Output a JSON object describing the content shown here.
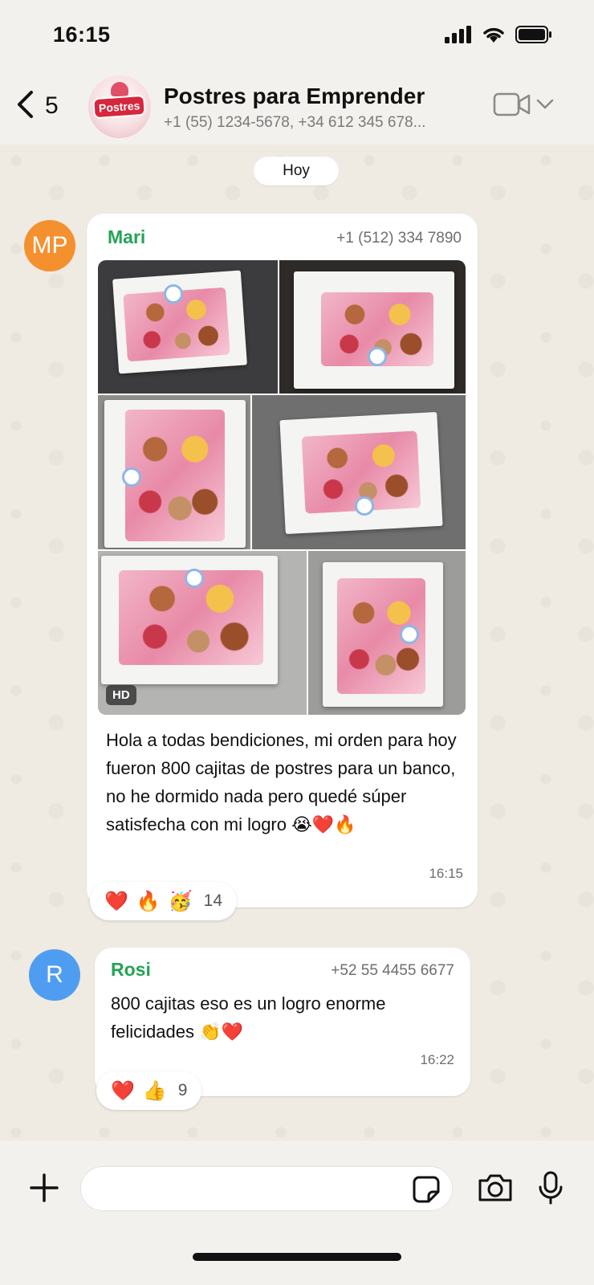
{
  "status_bar": {
    "time": "16:15"
  },
  "header": {
    "back_count": "5",
    "group_avatar_text": "Postres",
    "title": "Postres para Emprender",
    "subtitle": "+1 (55) 1234-5678, +34 612 345 678..."
  },
  "date_chip": "Hoy",
  "messages": [
    {
      "avatar_initials": "MP",
      "avatar_color": "#f5902f",
      "sender": "Mari",
      "phone": "+1 (512) 334 7890",
      "photos_count": 6,
      "hd_label": "HD",
      "text": "Hola a todas bendiciones, mi orden para hoy fueron 800 cajitas de postres para un banco, no he dormido nada pero quedé súper satisfecha con mi logro 😭❤️🔥",
      "time": "16:15",
      "reactions": [
        "❤️",
        "🔥",
        "🥳"
      ],
      "reaction_count": "14"
    },
    {
      "avatar_initials": "R",
      "avatar_color": "#4f9df0",
      "sender": "Rosi",
      "phone": "+52 55 4455 6677",
      "text": "800 cajitas eso es un logro enorme felicidades 👏❤️",
      "time": "16:22",
      "reactions": [
        "❤️",
        "👍"
      ],
      "reaction_count": "9"
    }
  ],
  "input": {
    "placeholder": ""
  },
  "colors": {
    "sender_name": "#23a455",
    "wallpaper": "#efeae2",
    "bar_background": "#f3f1ee"
  }
}
